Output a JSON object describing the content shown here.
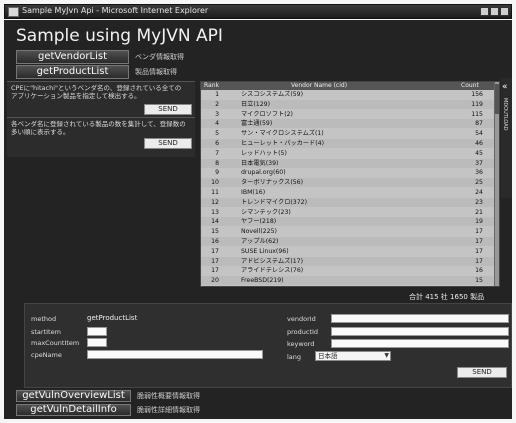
{
  "window": {
    "title": "Sample MyJvn Api - Microsoft Internet Explorer"
  },
  "page": {
    "heading": "Sample using MyJVN API"
  },
  "menu": {
    "vendor": {
      "label": "getVendorList",
      "desc": "ベンダ情報取得"
    },
    "product": {
      "label": "getProductList",
      "desc": "製品情報取得"
    },
    "vuln_overview": {
      "label": "getVulnOverviewList",
      "desc": "脆弱性概要情報取得"
    },
    "vuln_detail": {
      "label": "getVulnDetailInfo",
      "desc": "脆弱性詳細情報取得"
    }
  },
  "left": {
    "box1_text": "CPEに\"hitachi\"というベンダ名の、登録されている全てのアプリケーション製品を指定して検出する。",
    "box2_text": "各ベンダ名に登録されている製品の数を集計して、登録数の多い順に表示する。",
    "send_label": "SEND"
  },
  "list": {
    "col_rank": "Rank",
    "col_vendor": "Vendor Name (cid)",
    "col_count": "Count",
    "rows": [
      {
        "rank": "1",
        "vendor": "シスコシステムズ(59)",
        "count": "156"
      },
      {
        "rank": "2",
        "vendor": "日立(129)",
        "count": "119"
      },
      {
        "rank": "3",
        "vendor": "マイクロソフト(2)",
        "count": "115"
      },
      {
        "rank": "4",
        "vendor": "富士通(59)",
        "count": "87"
      },
      {
        "rank": "5",
        "vendor": "サン・マイクロシステムズ(1)",
        "count": "54"
      },
      {
        "rank": "6",
        "vendor": "ヒューレット・パッカード(4)",
        "count": "46"
      },
      {
        "rank": "7",
        "vendor": "レッドハット(5)",
        "count": "45"
      },
      {
        "rank": "8",
        "vendor": "日本電気(39)",
        "count": "37"
      },
      {
        "rank": "9",
        "vendor": "drupal.org(60)",
        "count": "36"
      },
      {
        "rank": "10",
        "vendor": "ターボリナックス(56)",
        "count": "25"
      },
      {
        "rank": "11",
        "vendor": "IBM(16)",
        "count": "24"
      },
      {
        "rank": "12",
        "vendor": "トレンドマイクロ(372)",
        "count": "23"
      },
      {
        "rank": "13",
        "vendor": "シマンテック(23)",
        "count": "21"
      },
      {
        "rank": "14",
        "vendor": "ヤフー(218)",
        "count": "19"
      },
      {
        "rank": "15",
        "vendor": "Novell(225)",
        "count": "17"
      },
      {
        "rank": "16",
        "vendor": "アップル(62)",
        "count": "17"
      },
      {
        "rank": "17",
        "vendor": "SUSE Linux(96)",
        "count": "17"
      },
      {
        "rank": "17",
        "vendor": "アドビシステムズ(17)",
        "count": "17"
      },
      {
        "rank": "17",
        "vendor": "アライドテレシス(76)",
        "count": "16"
      },
      {
        "rank": "20",
        "vendor": "FreeBSD(219)",
        "count": "15"
      }
    ],
    "total": "合計 415 社   1650 製品",
    "side_label": "MDOUTLOAD"
  },
  "form": {
    "method_label": "method",
    "method_value": "getProductList",
    "start_label": "startItem",
    "max_label": "maxCountItem",
    "cpe_label": "cpeName",
    "vendor_label": "vendorId",
    "product_label": "productId",
    "keyword_label": "keyword",
    "lang_label": "lang",
    "lang_value": "日本語",
    "send_label": "SEND"
  }
}
